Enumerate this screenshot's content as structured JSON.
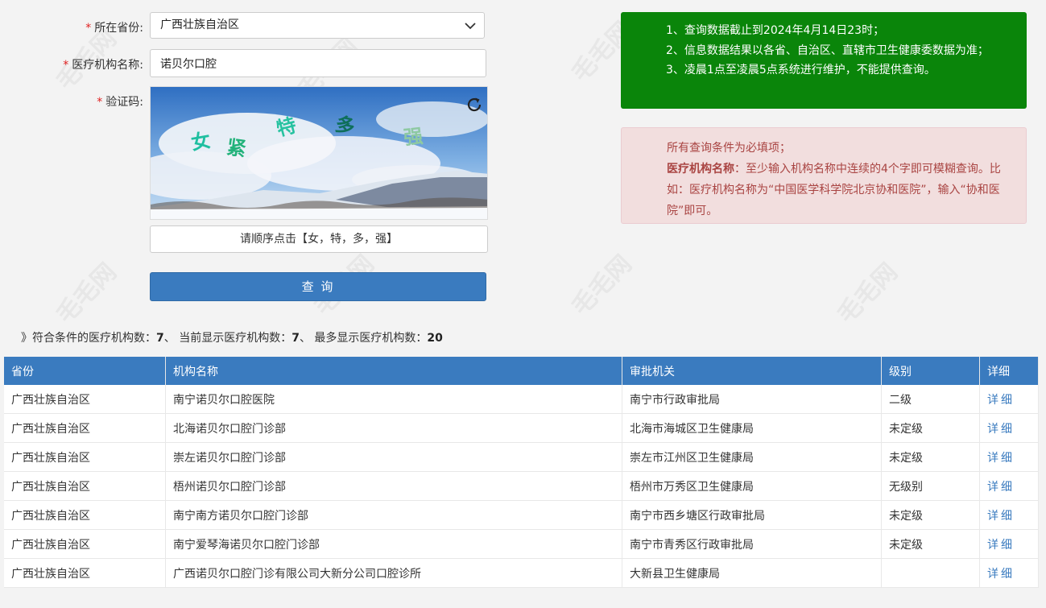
{
  "form": {
    "province_label": "所在省份:",
    "province_value": "广西壮族自治区",
    "org_label": "医疗机构名称:",
    "org_value": "诺贝尔口腔",
    "captcha_label": "验证码:",
    "captcha_chars": [
      "女",
      "紧",
      "特",
      "多",
      "强"
    ],
    "captcha_prompt": "请顺序点击【女，特，多，强】",
    "query_button": "查 询",
    "required_mark": "*"
  },
  "notice_green": {
    "line1": "1、查询数据截止到2024年4月14日23时；",
    "line2": "2、信息数据结果以各省、自治区、直辖市卫生健康委数据为准；",
    "line3": "3、凌晨1点至凌晨5点系统进行维护，不能提供查询。"
  },
  "notice_red": {
    "line1": "所有查询条件为必填项；",
    "line2_bold": "医疗机构名称",
    "line2_rest": "：至少输入机构名称中连续的4个字即可模糊查询。比如：医疗机构名称为“中国医学科学院北京协和医院”，输入“协和医院”即可。"
  },
  "summary": {
    "prefix": "》符合条件的医疗机构数：",
    "match_count": "7",
    "sep1": "、 当前显示医疗机构数：",
    "shown_count": "7",
    "sep2": "、 最多显示医疗机构数：",
    "max_count": "20"
  },
  "table": {
    "headers": [
      "省份",
      "机构名称",
      "审批机关",
      "级别",
      "详细"
    ],
    "rows": [
      [
        "广西壮族自治区",
        "南宁诺贝尔口腔医院",
        "南宁市行政审批局",
        "二级",
        "详细"
      ],
      [
        "广西壮族自治区",
        "北海诺贝尔口腔门诊部",
        "北海市海城区卫生健康局",
        "未定级",
        "详细"
      ],
      [
        "广西壮族自治区",
        "崇左诺贝尔口腔门诊部",
        "崇左市江州区卫生健康局",
        "未定级",
        "详细"
      ],
      [
        "广西壮族自治区",
        "梧州诺贝尔口腔门诊部",
        "梧州市万秀区卫生健康局",
        "无级别",
        "详细"
      ],
      [
        "广西壮族自治区",
        "南宁南方诺贝尔口腔门诊部",
        "南宁市西乡塘区行政审批局",
        "未定级",
        "详细"
      ],
      [
        "广西壮族自治区",
        "南宁爱琴海诺贝尔口腔门诊部",
        "南宁市青秀区行政审批局",
        "未定级",
        "详细"
      ],
      [
        "广西壮族自治区",
        "广西诺贝尔口腔门诊有限公司大新分公司口腔诊所",
        "大新县卫生健康局",
        "",
        "详细"
      ]
    ]
  },
  "watermark_text": "毛毛网",
  "colors": {
    "primary": "#3a7bbf",
    "notice_green": "#0a850a",
    "notice_red_bg": "#f2dede",
    "notice_red_text": "#a94442",
    "required": "#e02020"
  }
}
